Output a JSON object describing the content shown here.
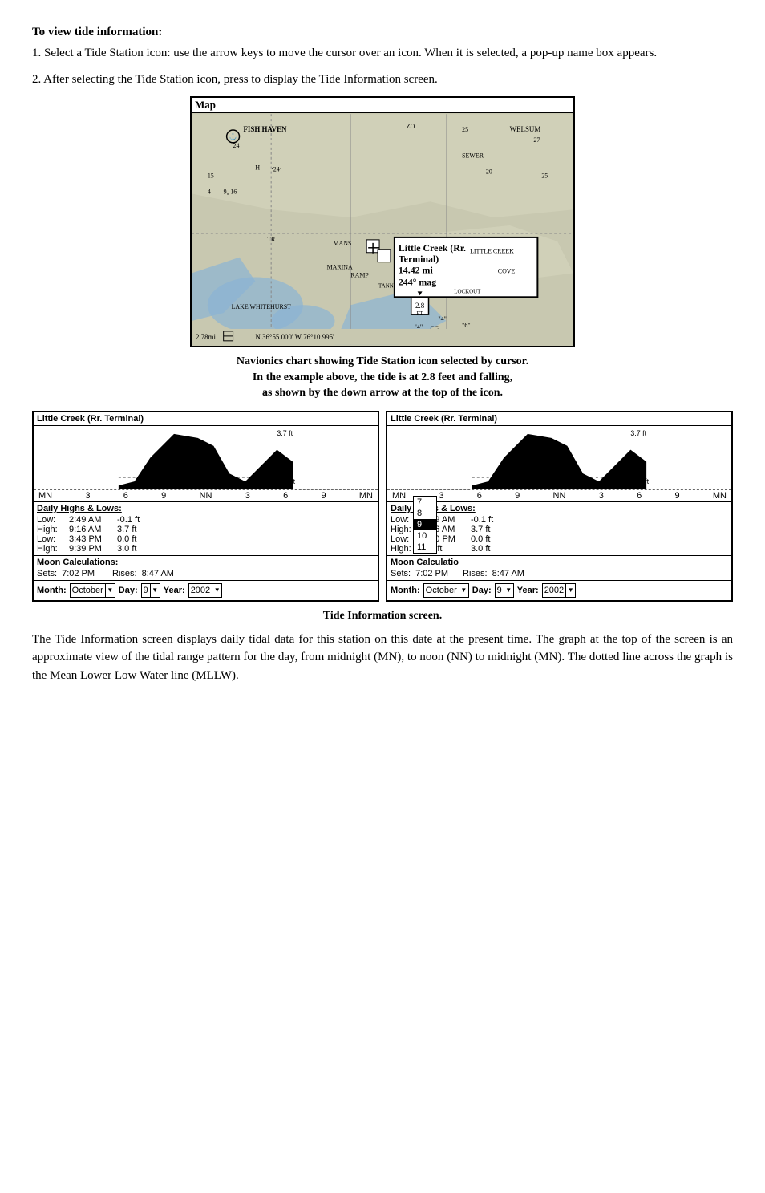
{
  "header": {
    "title": "To view tide information:"
  },
  "paragraphs": {
    "p1": "1. Select a Tide Station icon: use the arrow keys to move the cursor over an icon. When it is selected, a pop-up name box appears.",
    "p2": "2. After selecting the Tide Station icon, press      to display the Tide Information screen.",
    "map_caption_1": "Navionics chart showing Tide Station icon selected by cursor.",
    "map_caption_2": "In the example above, the tide is at 2.8 feet and falling,",
    "map_caption_3": "as shown by the down arrow at the top of the icon.",
    "tide_caption": "Tide Information screen.",
    "bottom": "The Tide Information screen displays daily tidal data for this station on this date at the present time. The graph at the top of the screen is an approximate view of the tidal range pattern for the day, from midnight (MN), to noon (NN) to midnight (MN). The dotted line across the graph is the Mean Lower Low Water line (MLLW)."
  },
  "map": {
    "title": "Map",
    "station_name": "Little Creek (Rr. Terminal)",
    "distance": "14.42 mi",
    "bearing": "244° mag",
    "coords": "N  36°55.000'  W  76°10.995'",
    "places": [
      "FISH HAVEN",
      "SEWER",
      "MARINA",
      "RAMP",
      "LAKE WHITEHURST",
      "LITTLE CREEK",
      "COVE",
      "TR",
      "CG"
    ],
    "tide_value": "2.8",
    "scale": "2.78mi"
  },
  "left_screen": {
    "title": "Little Creek (Rr. Terminal)",
    "max_label": "3.7 ft",
    "min_label": "-0.1 ft",
    "axis": [
      "MN",
      "3",
      "6",
      "9",
      "NN",
      "3",
      "6",
      "9",
      "MN"
    ],
    "section_title": "Daily Highs & Lows:",
    "rows": [
      {
        "label": "Low:",
        "time": "2:49 AM",
        "value": "-0.1 ft"
      },
      {
        "label": "High:",
        "time": "9:16 AM",
        "value": "3.7 ft"
      },
      {
        "label": "Low:",
        "time": "3:43 PM",
        "value": "0.0 ft"
      },
      {
        "label": "High:",
        "time": "9:39 PM",
        "value": "3.0 ft"
      }
    ],
    "moon_title": "Moon Calculations:",
    "sets_label": "Sets:",
    "sets_time": "7:02 PM",
    "rises_label": "Rises:",
    "rises_time": "8:47 AM",
    "month_label": "Month:",
    "day_label": "Day:",
    "year_label": "Year:",
    "month_value": "October",
    "day_value": "9",
    "year_value": "2002"
  },
  "right_screen": {
    "title": "Little Creek (Rr. Terminal)",
    "max_label": "3.7 ft",
    "min_label": "-0.1 ft",
    "axis": [
      "MN",
      "3",
      "6",
      "9",
      "NN",
      "3",
      "6",
      "9",
      "MN"
    ],
    "section_title": "Daily Highs & Lows:",
    "rows": [
      {
        "label": "Low:",
        "time": "2:49 AM",
        "value": "-0.1 ft"
      },
      {
        "label": "High:",
        "time": "9:16 AM",
        "value": "3.7 ft"
      },
      {
        "label": "Low:",
        "time": "3:10 PM",
        "value": "0.0 ft"
      },
      {
        "label": "High:",
        "time": "9:",
        "value": "3.0 ft"
      }
    ],
    "moon_title": "Moon Calculatio",
    "sets_label": "Sets:",
    "sets_time": "7:02 PM",
    "rises_label": "Rises:",
    "rises_time": "8:47 AM",
    "dropdown_items": [
      "7",
      "8",
      "9",
      "10",
      "11"
    ],
    "selected_day": "9",
    "month_label": "Month:",
    "day_label": "Day:",
    "year_label": "Year:",
    "month_value": "October",
    "day_value": "9",
    "year_value": "2002"
  }
}
